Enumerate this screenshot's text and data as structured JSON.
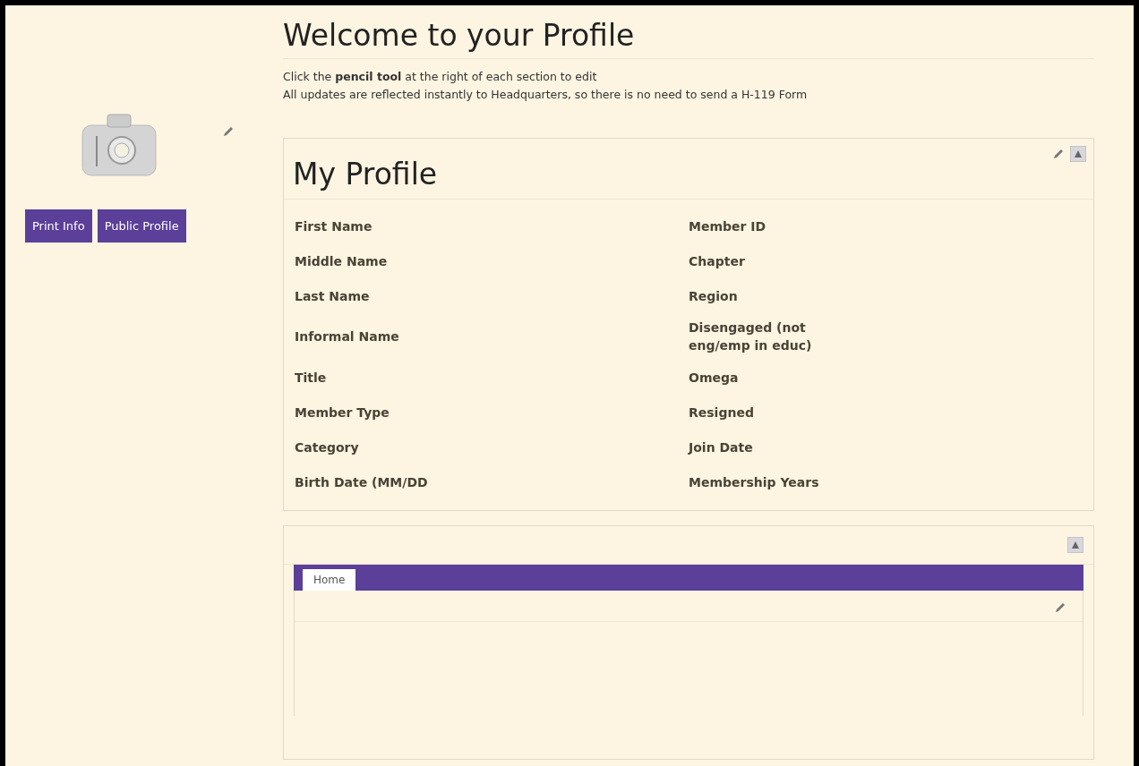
{
  "page_title": "Welcome to your Profile",
  "instructions": [
    "Click the **pencil tool** at the right of each section to edit",
    "All updates are reflected instantly to Headquarters, so there is no need to send a H-119 Form"
  ],
  "buttons": [
    "Print Info",
    "Public Profile"
  ],
  "profile": {
    "title": "My Profile",
    "left_fields": [
      "First Name",
      "Middle Name",
      "Last Name",
      "Informal Name",
      "Title",
      "Member Type",
      "Category",
      "Birth Date (MM/DD"
    ],
    "right_fields": [
      "Member ID",
      "Chapter",
      "Region",
      "Disengaged (not eng/emp in educ)",
      "Omega",
      "Resigned",
      "Join Date",
      "Membership Years"
    ]
  },
  "tabs": [
    {
      "label": "Home",
      "selected": true
    }
  ]
}
